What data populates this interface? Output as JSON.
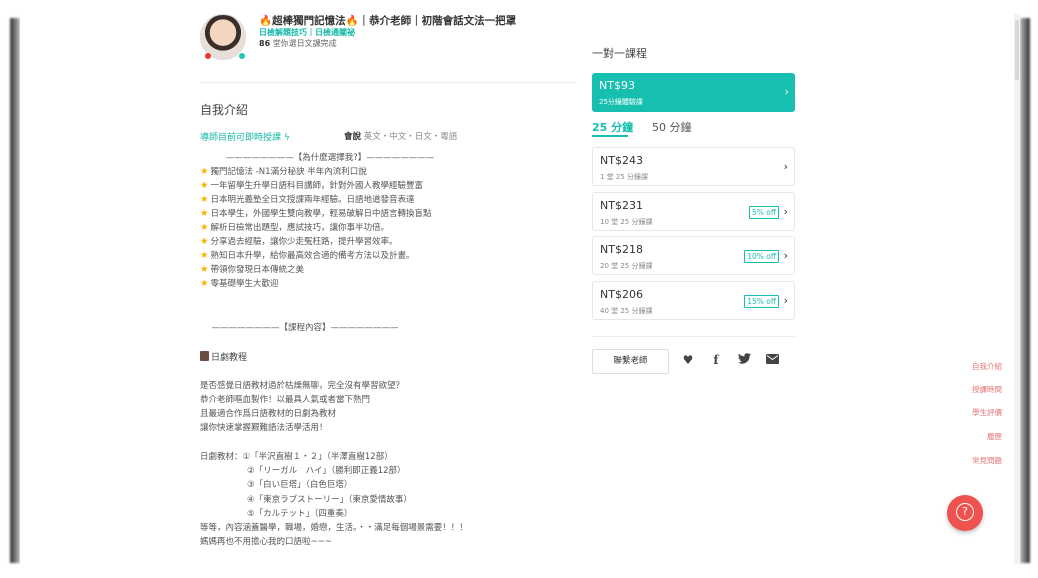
{
  "teacher": {
    "title": "🔥超棒獨門記憶法🔥｜恭介老師｜初階會話文法一把罩",
    "tags": "日檢解題技巧｜日檢通關祕",
    "count_num": "86",
    "count_text": "堂你選日文課完成"
  },
  "intro": {
    "heading": "自我介紹",
    "schedule_link": "導師目前可即時授課",
    "speaks_label": "會說",
    "languages": "英文・中文・日文・粵語",
    "why_heading": "————————【為什麼選擇我?】————————",
    "features": [
      "獨門記憶法 -N1滿分秘訣 半年內流利口說",
      "一年留學生升學日語科目講師，針對外國人教學經驗豐富",
      "日本明光義塾全日文授課兩年經驗。日語地道發音表達",
      "日本學生，外國學生雙向教學，輕易破解日中語言轉換盲點",
      "解析日檢常出題型，應試技巧，讓你事半功倍。",
      "分享過去經驗，讓你少走冤枉路，提升學習效率。",
      "熟知日本升學，給你最高效合適的備考方法以及計畫。",
      "帶領你發現日本傳統之美",
      "零基礎學生大歡迎"
    ],
    "course_heading": "————————【課程內容】————————",
    "drama_heading": "日劇教程",
    "drama_paragraph": [
      "是否感覺日語教材過於枯燥無聊，完全沒有學習欲望？",
      "恭介老師嘔血製作！以最具人氣或者當下熱門",
      "且最適合作爲日語教材的日劇為教材",
      "讓你快速掌握艱難語法活學活用！"
    ],
    "materials": [
      "日劇教材：①「半沢直樹１・２」（半澤直樹12部）",
      "②「リーガル　ハイ」（勝利即正義12部）",
      "③「白い巨塔」（白色巨塔）",
      "④「東京ラブストーリー」（東京愛情故事）",
      "⑤「カルテット」（四重奏）",
      "等等，內容涵蓋醫學，職場，婚戀，生活。・・滿足每個場景需要！！！",
      "媽媽再也不用擔心我的口語啦~~~"
    ]
  },
  "panel": {
    "title": "一對一課程",
    "trial": {
      "price": "NT$93",
      "sub": "25分鐘體驗課"
    },
    "tabs": [
      "25 分鐘",
      "50 分鐘"
    ],
    "packages": [
      {
        "price": "NT$243",
        "sub": "1 堂 25 分鐘課",
        "off": ""
      },
      {
        "price": "NT$231",
        "sub": "10 堂 25 分鐘課",
        "off": "5% off"
      },
      {
        "price": "NT$218",
        "sub": "20 堂 25 分鐘課",
        "off": "10% off"
      },
      {
        "price": "NT$206",
        "sub": "40 堂 25 分鐘課",
        "off": "15% off"
      }
    ],
    "contact": "聯繫老師"
  },
  "sidenav": [
    "自我介紹",
    "授課時間",
    "學生評價",
    "履歷",
    "常見問題"
  ],
  "icons": {
    "heart": "heart-icon",
    "facebook": "facebook-icon",
    "twitter": "twitter-icon",
    "mail": "mail-icon",
    "help": "help-icon"
  },
  "colors": {
    "accent": "#17bfb0",
    "nav": "#e57373",
    "help": "#ef5350"
  }
}
